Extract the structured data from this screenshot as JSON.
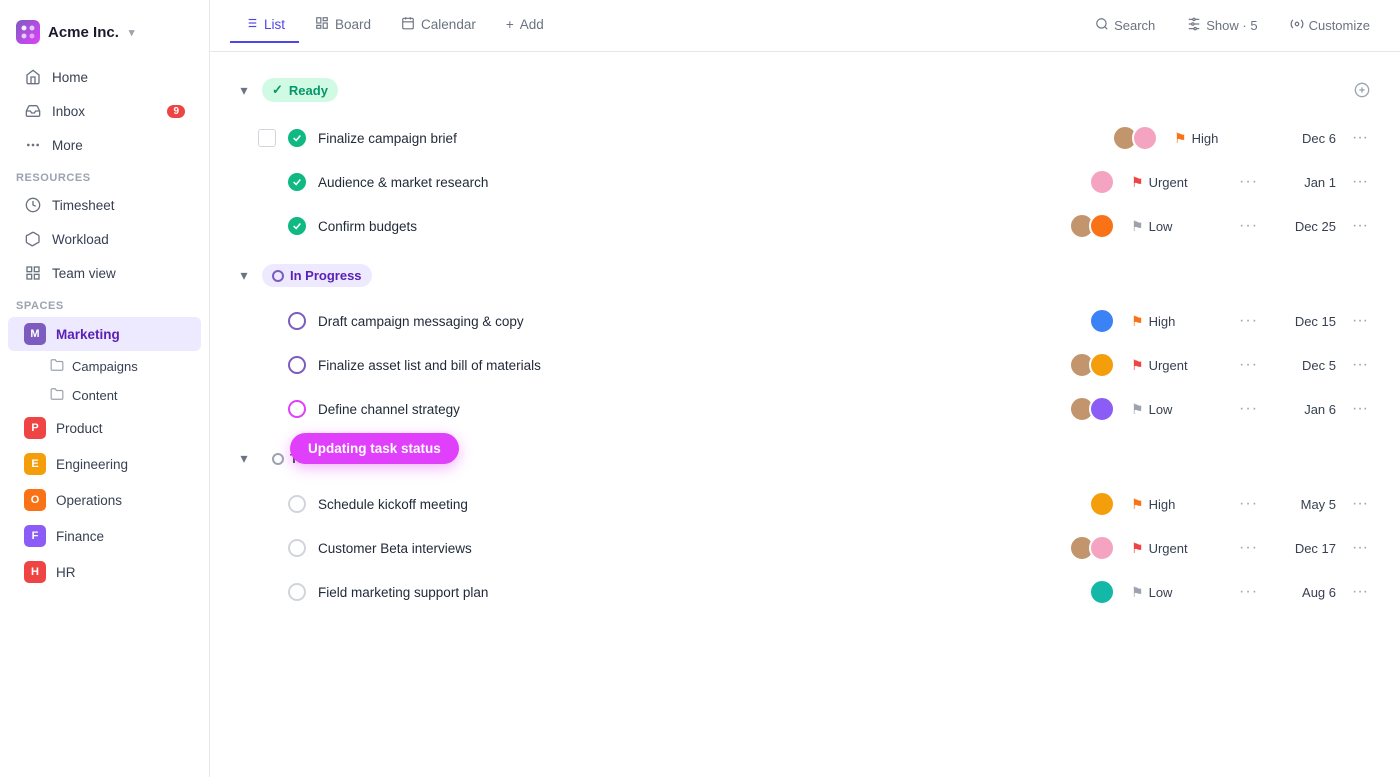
{
  "app": {
    "name": "Acme Inc.",
    "logo_text": "Acme Inc."
  },
  "sidebar": {
    "nav": [
      {
        "id": "home",
        "label": "Home",
        "icon": "home"
      },
      {
        "id": "inbox",
        "label": "Inbox",
        "badge": "9",
        "icon": "inbox"
      },
      {
        "id": "more",
        "label": "More",
        "icon": "more"
      }
    ],
    "resources_label": "Resources",
    "resources": [
      {
        "id": "timesheet",
        "label": "Timesheet",
        "icon": "clock"
      },
      {
        "id": "workload",
        "label": "Workload",
        "icon": "workload"
      },
      {
        "id": "teamview",
        "label": "Team view",
        "icon": "team"
      }
    ],
    "spaces_label": "Spaces",
    "spaces": [
      {
        "id": "marketing",
        "label": "Marketing",
        "color": "#7c5cbf",
        "active": true
      },
      {
        "id": "product",
        "label": "Product",
        "color": "#ef4444"
      },
      {
        "id": "engineering",
        "label": "Engineering",
        "color": "#f59e0b"
      },
      {
        "id": "operations",
        "label": "Operations",
        "color": "#f97316"
      },
      {
        "id": "finance",
        "label": "Finance",
        "color": "#8b5cf6"
      },
      {
        "id": "hr",
        "label": "HR",
        "color": "#ef4444"
      }
    ],
    "sub_items": [
      {
        "id": "campaigns",
        "label": "Campaigns",
        "parent": "marketing"
      },
      {
        "id": "content",
        "label": "Content",
        "parent": "marketing"
      }
    ]
  },
  "topbar": {
    "tabs": [
      {
        "id": "list",
        "label": "List",
        "active": true,
        "icon": "list"
      },
      {
        "id": "board",
        "label": "Board",
        "icon": "board"
      },
      {
        "id": "calendar",
        "label": "Calendar",
        "icon": "calendar"
      },
      {
        "id": "add",
        "label": "Add",
        "icon": "plus"
      }
    ],
    "search_label": "Search",
    "show_label": "Show · 5",
    "customize_label": "Customize"
  },
  "groups": [
    {
      "id": "ready",
      "label": "Ready",
      "type": "ready",
      "tasks": [
        {
          "id": "t1",
          "name": "Finalize campaign brief",
          "priority": "High",
          "priority_color": "orange",
          "date": "Dec 6",
          "avatars": [
            "av-brown",
            "av-pink"
          ],
          "has_checkbox": true,
          "status": "done"
        },
        {
          "id": "t2",
          "name": "Audience & market research",
          "priority": "Urgent",
          "priority_color": "red",
          "date": "Jan 1",
          "avatars": [
            "av-pink"
          ],
          "status": "done"
        },
        {
          "id": "t3",
          "name": "Confirm budgets",
          "priority": "Low",
          "priority_color": "gray",
          "date": "Dec 25",
          "avatars": [
            "av-brown",
            "av-orange"
          ],
          "status": "done"
        }
      ]
    },
    {
      "id": "in-progress",
      "label": "In Progress",
      "type": "in-progress",
      "tasks": [
        {
          "id": "t4",
          "name": "Draft campaign messaging & copy",
          "priority": "High",
          "priority_color": "orange",
          "date": "Dec 15",
          "avatars": [
            "av-blue"
          ],
          "status": "circle"
        },
        {
          "id": "t5",
          "name": "Finalize asset list and bill of materials",
          "priority": "Urgent",
          "priority_color": "red",
          "date": "Dec 5",
          "avatars": [
            "av-brown",
            "av-yellow"
          ],
          "status": "circle"
        },
        {
          "id": "t6",
          "name": "Define channel strategy",
          "priority": "Low",
          "priority_color": "gray",
          "date": "Jan 6",
          "avatars": [
            "av-brown",
            "av-purple"
          ],
          "status": "circle",
          "show_popup": true
        }
      ]
    },
    {
      "id": "todo",
      "label": "To Do",
      "type": "todo",
      "tasks": [
        {
          "id": "t7",
          "name": "Schedule kickoff meeting",
          "priority": "High",
          "priority_color": "orange",
          "date": "May 5",
          "avatars": [
            "av-yellow"
          ],
          "status": "empty"
        },
        {
          "id": "t8",
          "name": "Customer Beta interviews",
          "priority": "Urgent",
          "priority_color": "red",
          "date": "Dec 17",
          "avatars": [
            "av-brown",
            "av-pink"
          ],
          "status": "empty"
        },
        {
          "id": "t9",
          "name": "Field marketing support plan",
          "priority": "Low",
          "priority_color": "gray",
          "date": "Aug 6",
          "avatars": [
            "av-teal"
          ],
          "status": "empty"
        }
      ]
    }
  ],
  "popup": {
    "label": "Updating task status"
  }
}
